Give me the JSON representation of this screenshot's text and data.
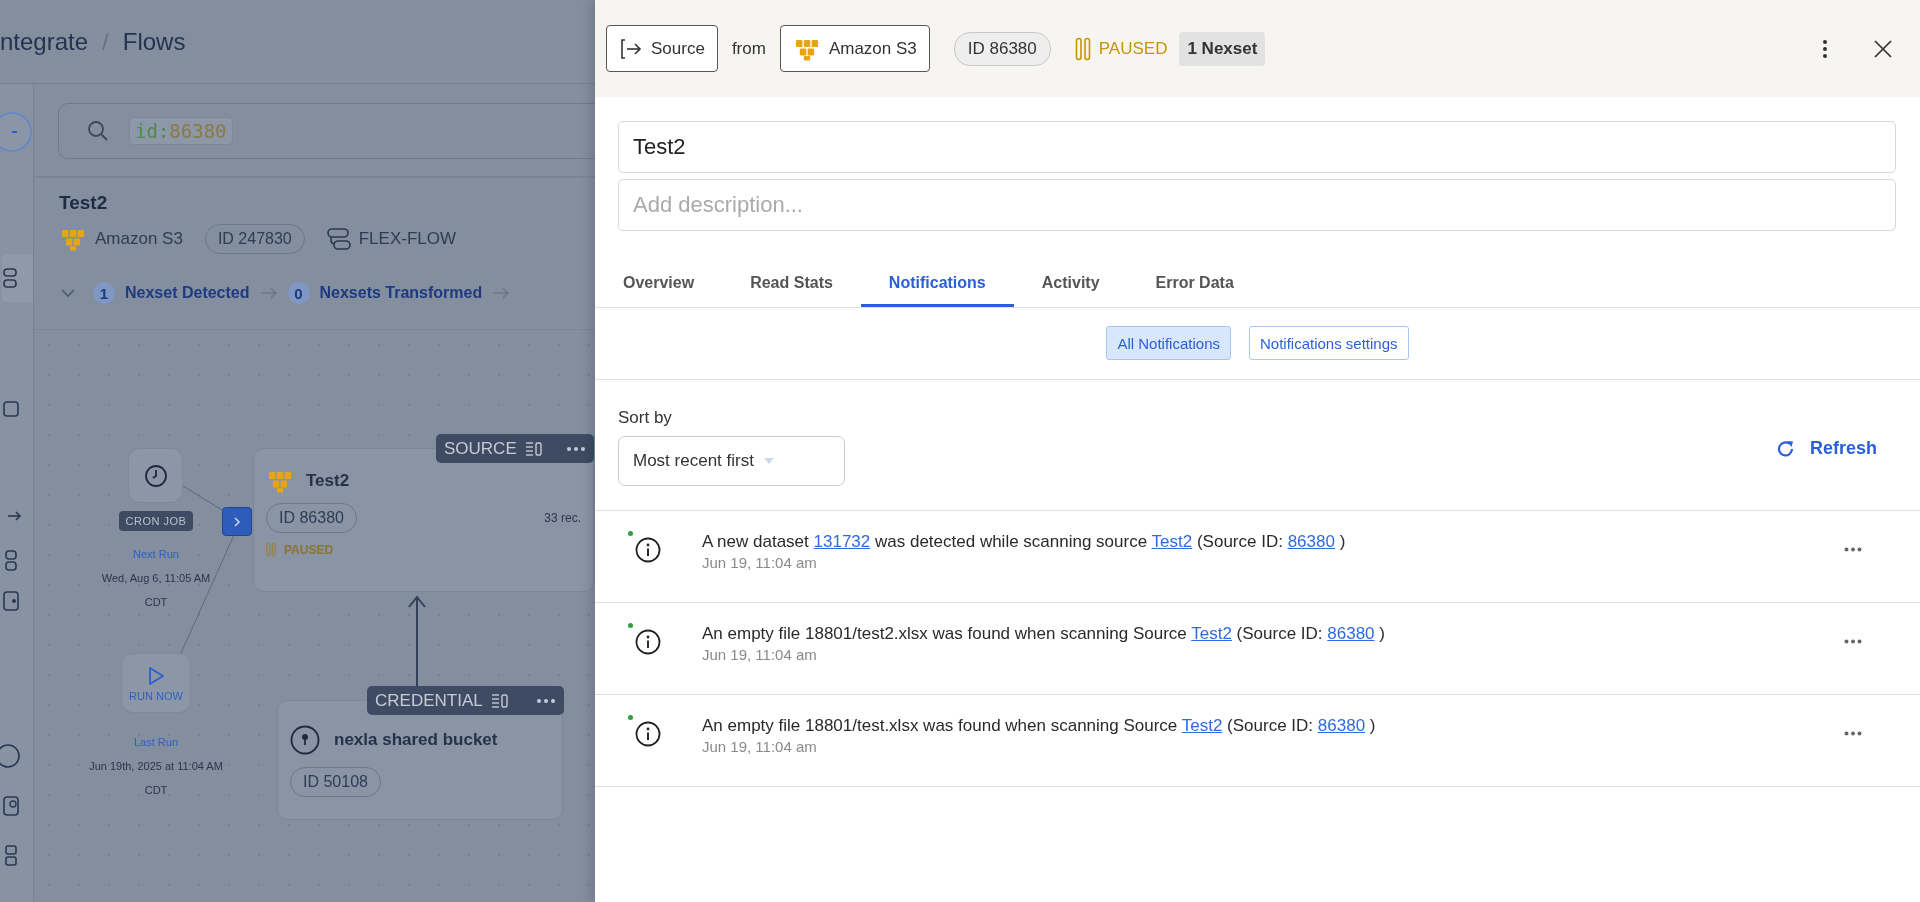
{
  "breadcrumb": {
    "items": [
      "ntegrate",
      "Flows"
    ],
    "separator": "/"
  },
  "search": {
    "filter_key": "id:",
    "filter_value": "86380"
  },
  "flow": {
    "title": "Test2",
    "connector": "Amazon S3",
    "id": "ID 247830",
    "type": "FLEX-FLOW",
    "stages": [
      {
        "count": "1",
        "label": "Nexset Detected"
      },
      {
        "count": "0",
        "label": "Nexsets Transformed"
      }
    ]
  },
  "canvas": {
    "cron": {
      "label": "CRON JOB",
      "next_run_label": "Next Run",
      "next_run": "Wed, Aug 6, 11:05 AM CDT"
    },
    "run_now": {
      "label": "RUN NOW",
      "last_run_label": "Last Run",
      "last_run": "Jun 19th, 2025 at 11:04 AM CDT"
    },
    "source_node": {
      "tag": "SOURCE",
      "title": "Test2",
      "id": "ID 86380",
      "records": "33 rec.",
      "status": "PAUSED"
    },
    "credential_node": {
      "tag": "CREDENTIAL",
      "title": "nexla shared bucket",
      "id": "ID 50108"
    }
  },
  "panel": {
    "resource_type": "Source",
    "from_label": "from",
    "connector": "Amazon S3",
    "id": "ID 86380",
    "status": "PAUSED",
    "nexsets": "1 Nexset",
    "name": "Test2",
    "description_placeholder": "Add description...",
    "tabs": [
      {
        "label": "Overview",
        "selected": false
      },
      {
        "label": "Read Stats",
        "selected": false
      },
      {
        "label": "Notifications",
        "selected": true
      },
      {
        "label": "Activity",
        "selected": false
      },
      {
        "label": "Error Data",
        "selected": false
      }
    ],
    "filters": [
      {
        "label": "All Notifications",
        "selected": true
      },
      {
        "label": "Notifications settings",
        "selected": false
      }
    ],
    "sort_label": "Sort by",
    "sort_value": "Most recent first",
    "refresh": "Refresh",
    "notifications": [
      {
        "unread": true,
        "parts": [
          {
            "text": "A new dataset ",
            "link": false
          },
          {
            "text": "131732",
            "link": true
          },
          {
            "text": " was detected while scanning source ",
            "link": false
          },
          {
            "text": "Test2",
            "link": true
          },
          {
            "text": " (Source ID: ",
            "link": false
          },
          {
            "text": "86380",
            "link": true
          },
          {
            "text": " )",
            "link": false
          }
        ],
        "time": "Jun 19, 11:04 am"
      },
      {
        "unread": true,
        "parts": [
          {
            "text": "An empty file 18801/test2.xlsx was found when scanning Source ",
            "link": false
          },
          {
            "text": "Test2",
            "link": true
          },
          {
            "text": " (Source ID: ",
            "link": false
          },
          {
            "text": "86380",
            "link": true
          },
          {
            "text": " )",
            "link": false
          }
        ],
        "time": "Jun 19, 11:04 am"
      },
      {
        "unread": true,
        "parts": [
          {
            "text": "An empty file 18801/test.xlsx was found when scanning Source ",
            "link": false
          },
          {
            "text": "Test2",
            "link": true
          },
          {
            "text": " (Source ID: ",
            "link": false
          },
          {
            "text": "86380",
            "link": true
          },
          {
            "text": " )",
            "link": false
          }
        ],
        "time": "Jun 19, 11:04 am"
      }
    ]
  }
}
